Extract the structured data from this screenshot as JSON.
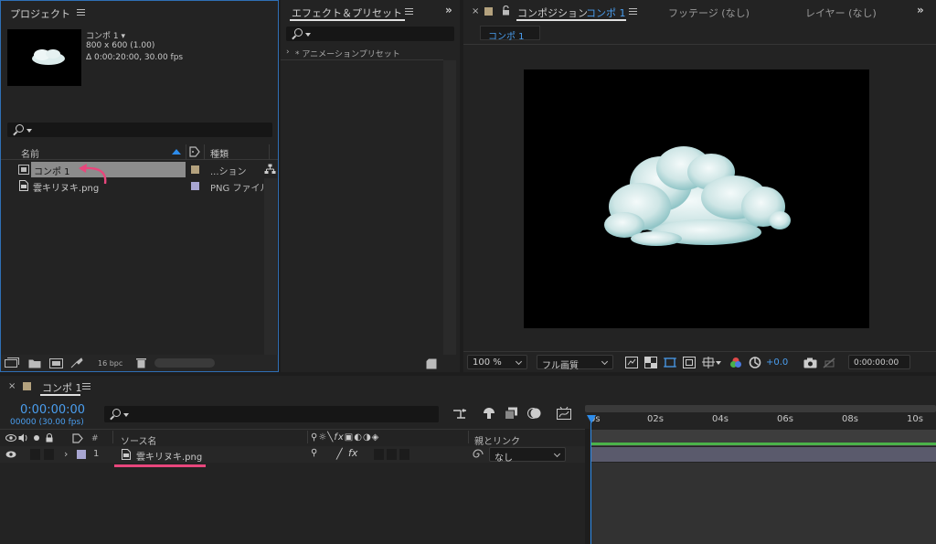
{
  "project": {
    "title": "プロジェクト",
    "comp_name": "コンポ 1 ▾",
    "comp_size": "800 x 600 (1.00)",
    "comp_duration": "Δ 0:00:20:00, 30.00 fps",
    "col_name": "名前",
    "col_type": "種類",
    "items": [
      {
        "name": "コンポ 1",
        "type": "...ション",
        "label_color": "#b4a27e"
      },
      {
        "name": "雲キリヌキ.png",
        "type": "PNG ファイル",
        "label_color": "#a8a6d2"
      }
    ],
    "bpc": "16 bpc"
  },
  "effects": {
    "title": "エフェクト＆プリセット",
    "item": "* アニメーションプリセット"
  },
  "composition": {
    "tab_label": "コンポジション",
    "tab_name": "コンポ 1",
    "footage_tab": "フッテージ (なし)",
    "layer_tab": "レイヤー (なし)",
    "subtab": "コンポ 1",
    "zoom": "100 %",
    "quality": "フル画質",
    "exposure": "+0.0",
    "timecode": "0:00:00:00"
  },
  "timeline": {
    "tab_name": "コンポ 1",
    "timecode": "0:00:00:00",
    "frames": "00000 (30.00 fps)",
    "col_hash": "#",
    "col_source": "ソース名",
    "col_parent": "親とリンク",
    "layer": {
      "index": "1",
      "name": "雲キリヌキ.png",
      "parent": "なし",
      "label_color": "#a8a6d2"
    },
    "ticks": [
      "0s",
      "02s",
      "04s",
      "06s",
      "08s",
      "10s"
    ]
  },
  "colors": {
    "accent": "#2d8ceb",
    "annotation": "#e8467c",
    "work_area": "#4bb34a"
  }
}
